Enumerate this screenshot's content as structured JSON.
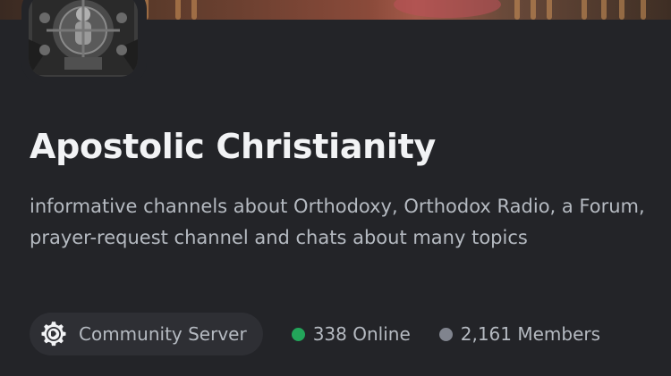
{
  "server": {
    "name": "Apostolic Christianity",
    "description": "informative channels about Orthodoxy, Orthodox Radio, a Forum, prayer-request channel and chats about many topics",
    "icon": "icon-image"
  },
  "badges": {
    "community_label": "Community Server",
    "community_icon": "gear-globe-icon"
  },
  "stats": {
    "online_label": "338 Online",
    "members_label": "2,161 Members"
  },
  "colors": {
    "background": "#232428",
    "online_dot": "#23a55a",
    "members_dot": "#80848e",
    "title": "#f2f3f5",
    "muted_text": "#b5bac1"
  }
}
